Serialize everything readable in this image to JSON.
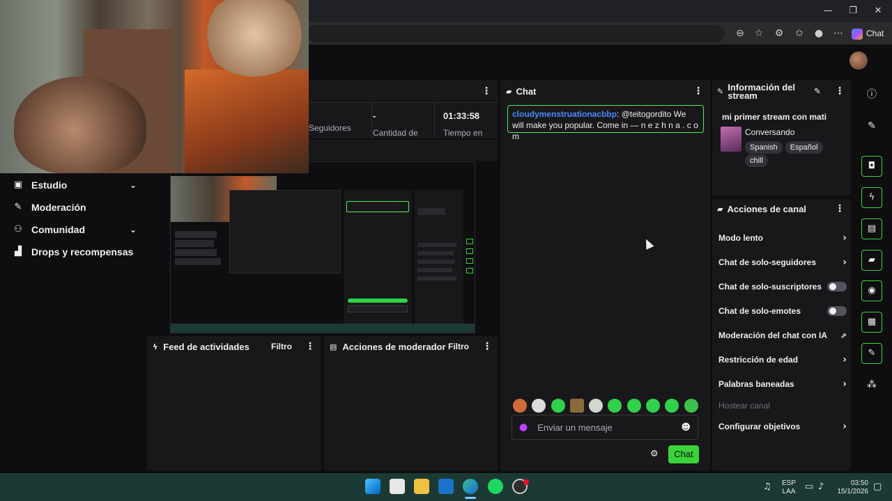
{
  "browser": {
    "copilot_label": "Chat",
    "window_controls": [
      "—",
      "❐",
      "✕"
    ]
  },
  "sidebar": {
    "items": [
      {
        "label": "Estudio",
        "icon": "studio-icon",
        "expandable": true
      },
      {
        "label": "Moderación",
        "icon": "wrench-icon",
        "expandable": false
      },
      {
        "label": "Comunidad",
        "icon": "community-icon",
        "expandable": true
      },
      {
        "label": "Drops y recompensas",
        "icon": "drops-icon",
        "expandable": false
      }
    ]
  },
  "stats": {
    "items": [
      {
        "value": "",
        "label": "Seguidores"
      },
      {
        "value": "-",
        "label": "Cantidad de"
      },
      {
        "value": "01:33:58",
        "label": "Tiempo en"
      }
    ]
  },
  "chat": {
    "title": "Chat",
    "message": {
      "user": "cloudymenstruationacbbp",
      "text": ": @teitogordito We will make you popular. Come in — n e z h n a . c o m"
    },
    "input_placeholder": "Enviar un mensaje",
    "send_label": "Chat"
  },
  "stream_info": {
    "title": "Información del stream",
    "stream_title": "mi primer stream con mati",
    "category": "Conversando",
    "tags": [
      "Spanish",
      "Español",
      "chill"
    ]
  },
  "channel_actions": {
    "title": "Acciones de canal",
    "items": [
      {
        "label": "Modo lento",
        "control": "arrow"
      },
      {
        "label": "Chat de solo-seguidores",
        "control": "arrow"
      },
      {
        "label": "Chat de solo-suscriptores",
        "control": "toggle"
      },
      {
        "label": "Chat de solo-emotes",
        "control": "toggle"
      },
      {
        "label": "Moderación del chat con IA",
        "control": "external"
      },
      {
        "label": "Restricción de edad",
        "control": "arrow"
      },
      {
        "label": "Palabras baneadas",
        "control": "arrow"
      },
      {
        "label": "Hostear canal",
        "control": "none"
      },
      {
        "label": "Configurar objetivos",
        "control": "arrow"
      }
    ]
  },
  "activity_feed": {
    "title": "Feed de actividades",
    "filter_label": "Filtro"
  },
  "mod_actions": {
    "title": "Acciones de moderador",
    "filter_label": "Filtro"
  },
  "taskbar": {
    "lang": "ESP",
    "lang2": "LAA",
    "time": "03:50",
    "date": "15/1/2026"
  },
  "colors": {
    "accent_green": "#3bd33b",
    "chat_border": "#56f05a",
    "username_blue": "#4a8cff",
    "panel_bg": "#18181b",
    "page_bg": "#0e0e10"
  }
}
